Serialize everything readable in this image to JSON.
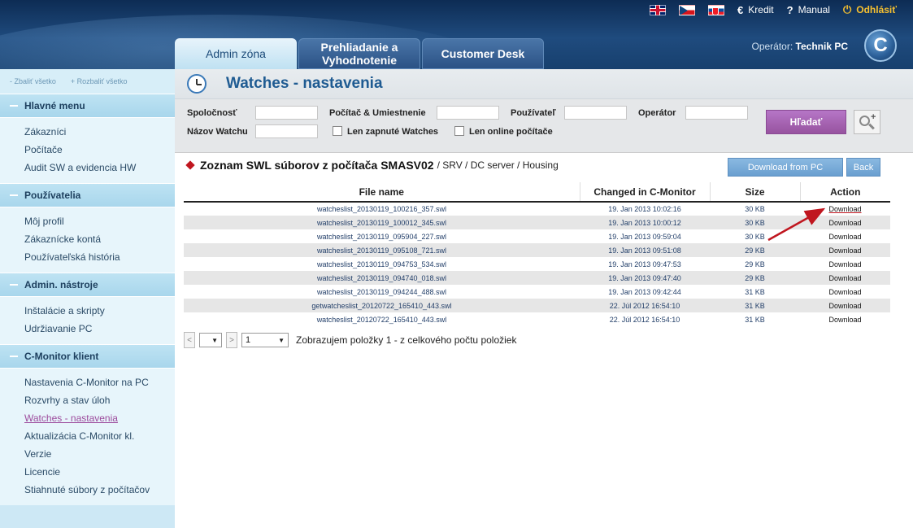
{
  "header": {
    "top_links": {
      "kredit": "Kredit",
      "manual": "Manual",
      "logout": "Odhlásiť"
    },
    "tabs": [
      "Admin zóna",
      "Prehliadanie a Vyhodnotenie",
      "Customer Desk"
    ],
    "operator_label": "Operátor:",
    "operator_name": "Technik PC",
    "logo_letter": "C"
  },
  "sidebar": {
    "collapse_all": "- Zbaliť všetko",
    "expand_all": "+ Rozbaliť všetko",
    "sections": [
      {
        "title": "Hlavné menu",
        "items": [
          "Zákazníci",
          "Počítače",
          "Audit SW a evidencia HW"
        ]
      },
      {
        "title": "Používatelia",
        "items": [
          "Môj profil",
          "Zákaznícke kontá",
          "Používateľská história"
        ]
      },
      {
        "title": "Admin. nástroje",
        "items": [
          "Inštalácie a skripty",
          "Udržiavanie PC"
        ]
      },
      {
        "title": "C-Monitor klient",
        "items": [
          "Nastavenia C-Monitor na PC",
          "Rozvrhy a stav úloh",
          "Watches - nastavenia",
          "Aktualizácia C-Monitor kl.",
          "Verzie",
          "Licencie",
          "Stiahnuté súbory z počítačov"
        ]
      }
    ]
  },
  "page": {
    "title": "Watches - nastavenia"
  },
  "filter": {
    "company_label": "Spoločnosť",
    "computer_label": "Počítač & Umiestnenie",
    "user_label": "Používateľ",
    "operator_label": "Operátor",
    "watch_name_label": "Názov Watchu",
    "only_enabled_label": "Len zapnuté Watches",
    "only_online_label": "Len online počítače",
    "search_button": "Hľadať"
  },
  "list": {
    "title": "Zoznam SWL súborov z počítača SMASV02",
    "crumb": "/ SRV / DC server / Housing",
    "download_from_pc": "Download from PC",
    "back": "Back",
    "columns": [
      "File name",
      "Changed in C-Monitor",
      "Size",
      "Action"
    ],
    "rows": [
      {
        "file": "watcheslist_20130119_100216_357.swl",
        "changed": "19. Jan 2013 10:02:16",
        "size": "30 KB",
        "action": "Download"
      },
      {
        "file": "watcheslist_20130119_100012_345.swl",
        "changed": "19. Jan 2013 10:00:12",
        "size": "30 KB",
        "action": "Download"
      },
      {
        "file": "watcheslist_20130119_095904_227.swl",
        "changed": "19. Jan 2013 09:59:04",
        "size": "30 KB",
        "action": "Download"
      },
      {
        "file": "watcheslist_20130119_095108_721.swl",
        "changed": "19. Jan 2013 09:51:08",
        "size": "29 KB",
        "action": "Download"
      },
      {
        "file": "watcheslist_20130119_094753_534.swl",
        "changed": "19. Jan 2013 09:47:53",
        "size": "29 KB",
        "action": "Download"
      },
      {
        "file": "watcheslist_20130119_094740_018.swl",
        "changed": "19. Jan 2013 09:47:40",
        "size": "29 KB",
        "action": "Download"
      },
      {
        "file": "watcheslist_20130119_094244_488.swl",
        "changed": "19. Jan 2013 09:42:44",
        "size": "31 KB",
        "action": "Download"
      },
      {
        "file": "getwatcheslist_20120722_165410_443.swl",
        "changed": "22. Júl 2012 16:54:10",
        "size": "31 KB",
        "action": "Download"
      },
      {
        "file": "watcheslist_20120722_165410_443.swl",
        "changed": "22. Júl 2012 16:54:10",
        "size": "31 KB",
        "action": "Download"
      }
    ]
  },
  "pager": {
    "prev": "<",
    "next": ">",
    "per_page": "1",
    "summary": "Zobrazujem položky 1 - z celkového počtu položiek"
  },
  "colors": {
    "accent_purple": "#97539f",
    "header_blue": "#1f4b7e",
    "sidebar_bg": "#cde8f5",
    "arrow_red": "#c0161f"
  }
}
